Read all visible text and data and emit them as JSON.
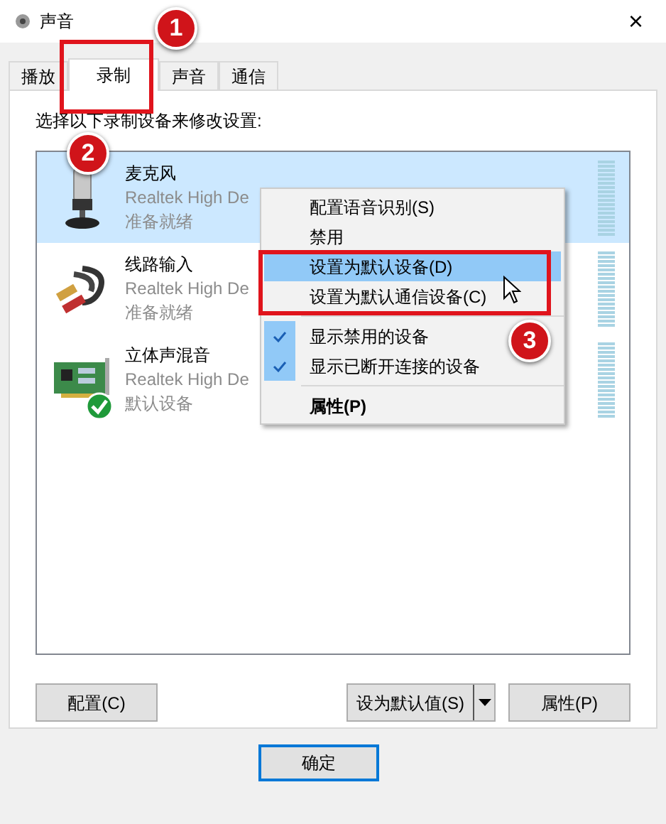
{
  "window": {
    "title": "声音",
    "close": "×"
  },
  "tabs": [
    {
      "label": "播放",
      "selected": false
    },
    {
      "label": "录制",
      "selected": true
    },
    {
      "label": "声音",
      "selected": false
    },
    {
      "label": "通信",
      "selected": false
    }
  ],
  "instruction": "选择以下录制设备来修改设置:",
  "devices": [
    {
      "kind": "microphone",
      "name": "麦克风",
      "driver": "Realtek High De",
      "status": "准备就绪",
      "selected": true,
      "default": false
    },
    {
      "kind": "line-in",
      "name": "线路输入",
      "driver": "Realtek High De",
      "status": "准备就绪",
      "selected": false,
      "default": false
    },
    {
      "kind": "sound-card",
      "name": "立体声混音",
      "driver": "Realtek High De",
      "status": "默认设备",
      "selected": false,
      "default": true
    }
  ],
  "context_menu": [
    {
      "kind": "item",
      "label": "配置语音识别(S)",
      "highlighted": false,
      "checked": false,
      "bold": false
    },
    {
      "kind": "item",
      "label": "禁用",
      "highlighted": false,
      "checked": false,
      "bold": false
    },
    {
      "kind": "item",
      "label": "设置为默认设备(D)",
      "highlighted": true,
      "checked": false,
      "bold": false
    },
    {
      "kind": "item",
      "label": "设置为默认通信设备(C)",
      "highlighted": false,
      "checked": false,
      "bold": false
    },
    {
      "kind": "separator"
    },
    {
      "kind": "item",
      "label": "显示禁用的设备",
      "highlighted": false,
      "checked": true,
      "bold": false
    },
    {
      "kind": "item",
      "label": "显示已断开连接的设备",
      "highlighted": false,
      "checked": true,
      "bold": false
    },
    {
      "kind": "separator"
    },
    {
      "kind": "item",
      "label": "属性(P)",
      "highlighted": false,
      "checked": false,
      "bold": true
    }
  ],
  "buttons": {
    "configure": "配置(C)",
    "set_default": "设为默认值(S)",
    "properties": "属性(P)"
  },
  "dialog_buttons": [
    "确定"
  ],
  "annotations": [
    "1",
    "2",
    "3"
  ]
}
